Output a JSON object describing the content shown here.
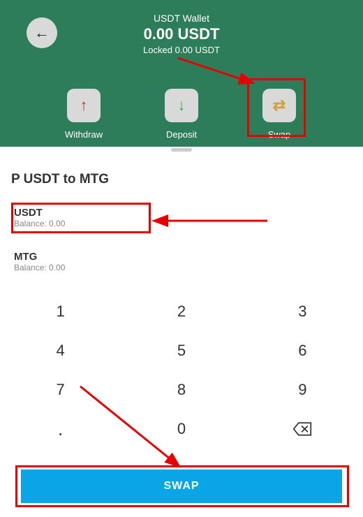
{
  "header": {
    "wallet_name": "USDT Wallet",
    "balance": "0.00 USDT",
    "locked": "Locked 0.00 USDT",
    "actions": {
      "withdraw": "Withdraw",
      "deposit": "Deposit",
      "swap": "Swap"
    }
  },
  "swap": {
    "title": "P USDT to MTG",
    "from": {
      "symbol": "USDT",
      "balance_label": "Balance: 0.00"
    },
    "to": {
      "symbol": "MTG",
      "balance_label": "Balance: 0.00"
    }
  },
  "keypad": {
    "k1": "1",
    "k2": "2",
    "k3": "3",
    "k4": "4",
    "k5": "5",
    "k6": "6",
    "k7": "7",
    "k8": "8",
    "k9": "9",
    "dot": ".",
    "k0": "0"
  },
  "swap_button": "SWAP",
  "colors": {
    "brand_green": "#2e7d5a",
    "cta_blue": "#0aa5e6",
    "highlight_red": "#e60000"
  }
}
